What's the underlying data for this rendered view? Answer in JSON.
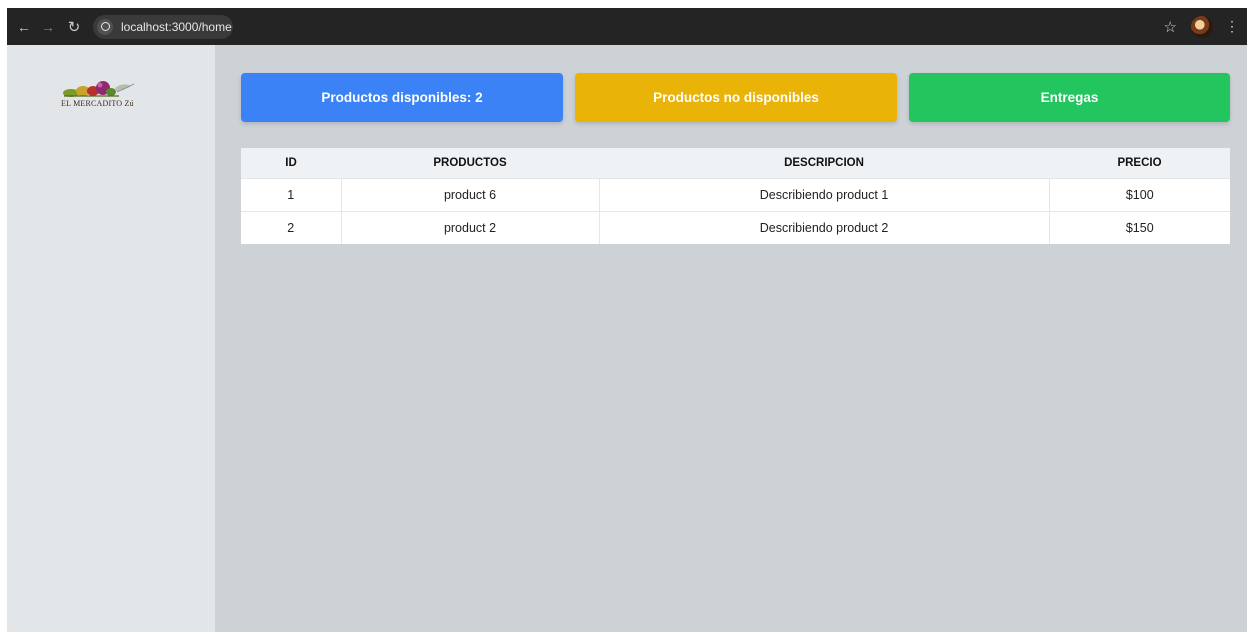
{
  "browser": {
    "url": "localhost:3000/home",
    "back_icon": "arrow-left-icon",
    "forward_icon": "arrow-right-icon",
    "reload_icon": "reload-icon",
    "bookmark_icon": "star-icon",
    "menu_icon": "kebab-menu-icon"
  },
  "sidebar": {
    "logo_text": "EL MERCADITO Zú"
  },
  "cards": {
    "available": "Productos disponibles: 2",
    "unavailable": "Productos no disponibles",
    "deliveries": "Entregas"
  },
  "colors": {
    "blue": "#3b82f6",
    "yellow": "#eab308",
    "green": "#22c55e"
  },
  "table": {
    "headers": [
      "ID",
      "PRODUCTOS",
      "DESCRIPCION",
      "PRECIO"
    ],
    "rows": [
      [
        "1",
        "product 6",
        "Describiendo product 1",
        "$100"
      ],
      [
        "2",
        "product 2",
        "Describiendo product 2",
        "$150"
      ]
    ]
  }
}
